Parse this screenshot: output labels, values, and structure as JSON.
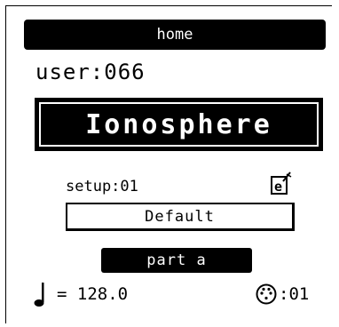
{
  "header": {
    "title": "home"
  },
  "user": {
    "label": "user:066"
  },
  "preset": {
    "name": "Ionosphere"
  },
  "setup": {
    "label": "setup:01",
    "edit_icon": "edit-document-icon"
  },
  "field": {
    "value": "Default"
  },
  "part": {
    "label": "part a"
  },
  "tempo": {
    "icon": "quarter-note-icon",
    "value": "= 128.0"
  },
  "midi": {
    "icon": "midi-port-icon",
    "value": ":01"
  },
  "colors": {
    "foreground": "#000000",
    "background": "#ffffff"
  }
}
